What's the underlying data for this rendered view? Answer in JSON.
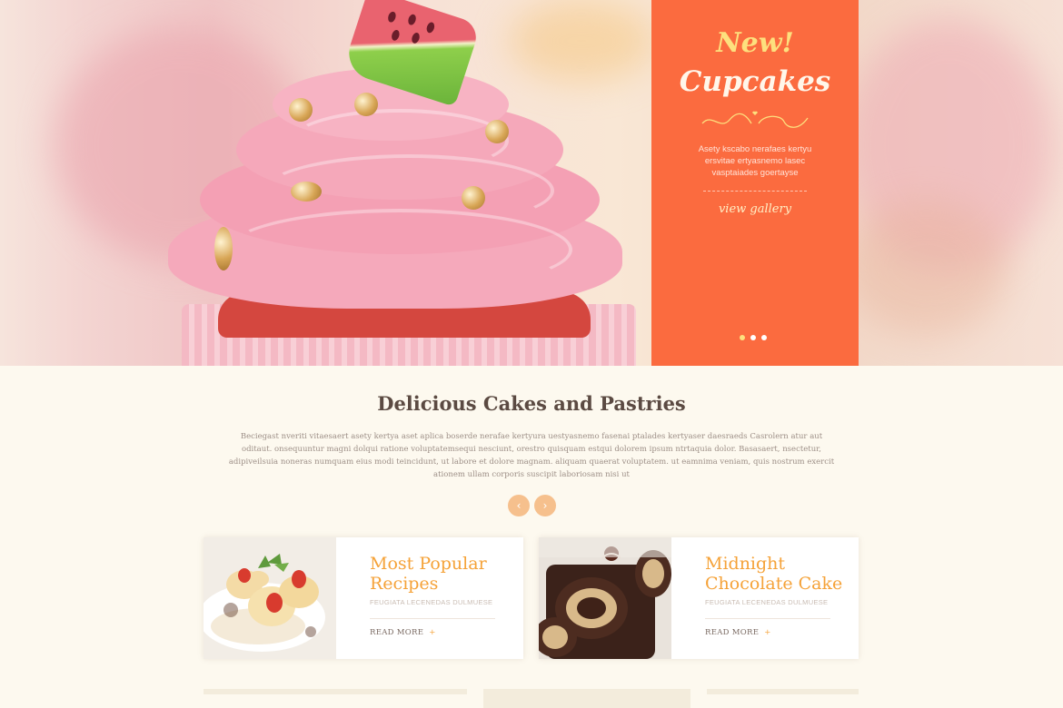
{
  "hero": {
    "promo": {
      "badge": "New!",
      "title": "Cupcakes",
      "text": "Asety kscabo nerafaes kertyu ersvitae ertyasnemo lasec vasptaiades goertayse",
      "link_label": "view gallery",
      "slides": 3,
      "active_slide": 1
    },
    "icons": [
      "ornament-icon"
    ]
  },
  "intro": {
    "title": "Delicious Cakes and Pastries",
    "text": "Beciegast nveriti vitaesaert asety kertya aset aplica boserde nerafae kertyura uestyasnemo fasenai ptalades kertyaser daesraeds Casrolern atur aut oditaut. onsequuntur magni dolqui ratione voluptatemsequi nesciunt, orestro quisquam estqui dolorem ipsum ntrtaquia dolor. Basasaert, nsectetur, adipiveilsuia noneras numquam eius modi teincidunt, ut labore et dolore magnam. aliquam quaerat voluptatem. ut eamnima veniam, quis nostrum exercit ationem ullam corporis suscipit laboriosam nisi ut",
    "prev_icon": "‹",
    "next_icon": "›"
  },
  "cards": [
    {
      "title": "Most Popular Recipes",
      "subtitle": "FEUGIATA LECENEDAS DULMUESE",
      "more_label": "READ MORE",
      "more_icon": "+"
    },
    {
      "title": "Midnight Chocolate Cake",
      "subtitle": "FEUGIATA LECENEDAS DULMUESE",
      "more_label": "READ MORE",
      "more_icon": "+"
    }
  ],
  "colors": {
    "accent_orange": "#fb6b3f",
    "title_gold": "#f5a238",
    "badge_yellow": "#fde07e",
    "arrow_peach": "#f6c08d",
    "background": "#fdf9ef"
  }
}
